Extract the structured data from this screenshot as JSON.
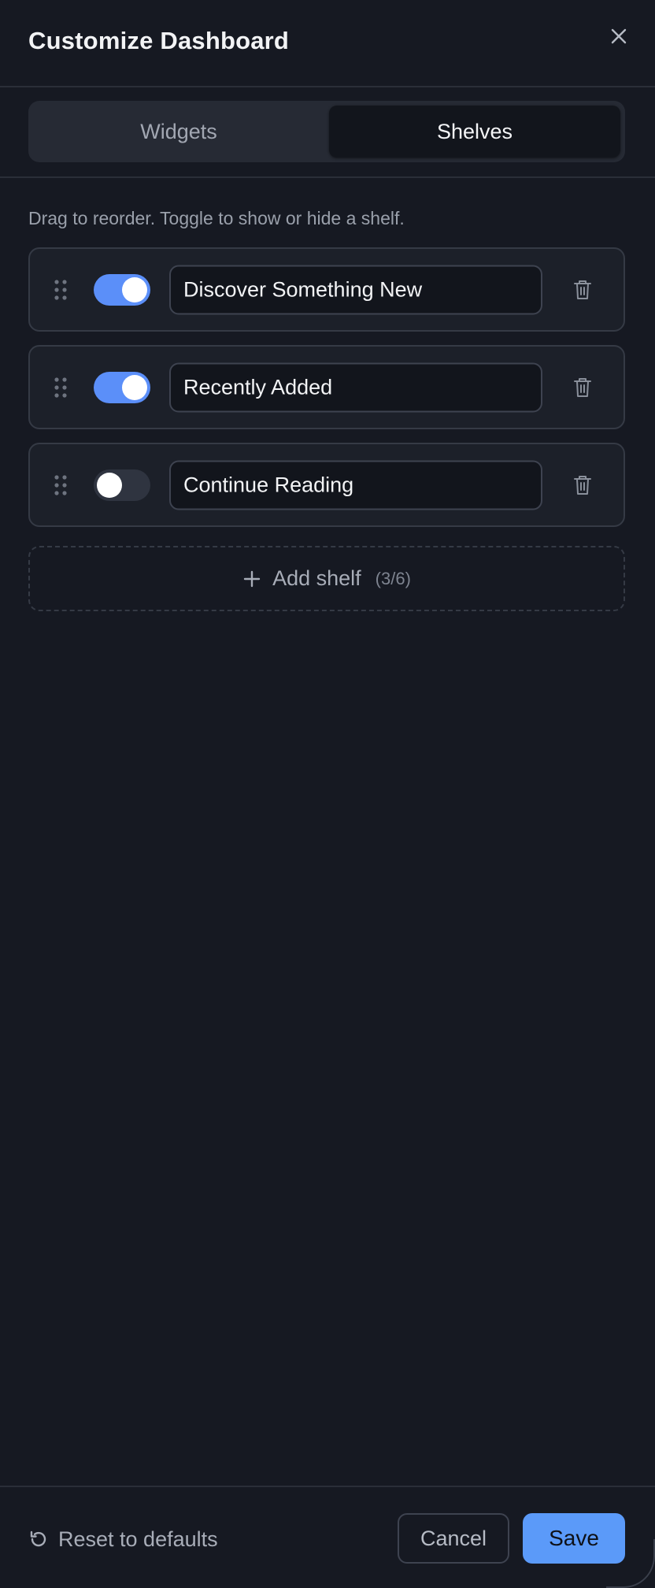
{
  "dialog": {
    "title": "Customize Dashboard",
    "close_icon": "close-icon"
  },
  "tabs": [
    {
      "label": "Widgets",
      "active": false
    },
    {
      "label": "Shelves",
      "active": true
    }
  ],
  "hint": "Drag to reorder. Toggle to show or hide a shelf.",
  "shelves": [
    {
      "name": "Discover Something New",
      "enabled": true
    },
    {
      "name": "Recently Added",
      "enabled": true
    },
    {
      "name": "Continue Reading",
      "enabled": false
    }
  ],
  "add_shelf": {
    "label": "Add shelf",
    "count": "(3/6)"
  },
  "footer": {
    "reset_label": "Reset to defaults",
    "cancel_label": "Cancel",
    "save_label": "Save"
  },
  "colors": {
    "background": "#161922",
    "accent": "#5b9af9",
    "toggle_on": "#5b8ff9",
    "toggle_off": "#2f3440"
  }
}
